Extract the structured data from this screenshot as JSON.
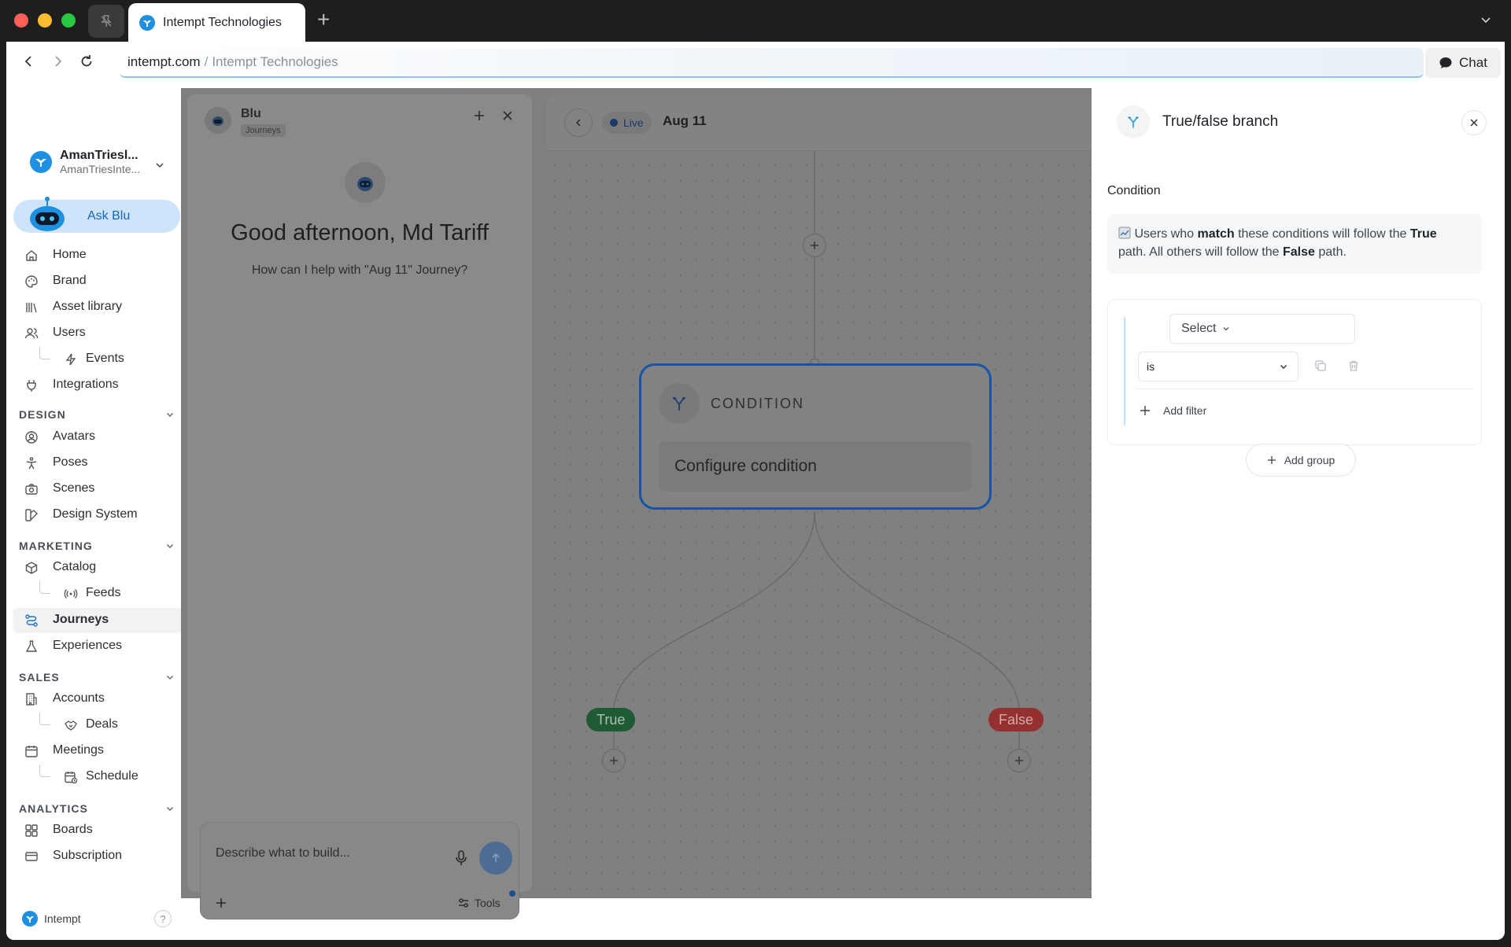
{
  "browser": {
    "tab_title": "Intempt Technologies",
    "url_domain": "intempt.com",
    "url_separator": "/",
    "url_path": "Intempt Technologies",
    "chat_label": "Chat"
  },
  "sidebar": {
    "workspace_name": "AmanTriesl...",
    "workspace_sub": "AmanTriesInte...",
    "ask_blu": "Ask Blu",
    "items": {
      "home": "Home",
      "brand": "Brand",
      "asset_library": "Asset library",
      "users": "Users",
      "events": "Events",
      "integrations": "Integrations",
      "avatars": "Avatars",
      "poses": "Poses",
      "scenes": "Scenes",
      "design_system": "Design System",
      "catalog": "Catalog",
      "feeds": "Feeds",
      "journeys": "Journeys",
      "experiences": "Experiences",
      "accounts": "Accounts",
      "deals": "Deals",
      "meetings": "Meetings",
      "schedule": "Schedule",
      "boards": "Boards",
      "subscription": "Subscription"
    },
    "sections": {
      "design": "DESIGN",
      "marketing": "MARKETING",
      "sales": "SALES",
      "analytics": "ANALYTICS"
    },
    "footer_brand": "Intempt",
    "help": "?"
  },
  "blu_panel": {
    "name": "Blu",
    "tag": "Journeys",
    "greeting": "Good afternoon, Md Tariff",
    "subtitle": "How can I help with \"Aug 11\" Journey?",
    "input_placeholder": "Describe what to build...",
    "tools_label": "Tools"
  },
  "canvas": {
    "status": "Live",
    "title": "Aug 11",
    "condition_title": "CONDITION",
    "condition_config": "Configure condition",
    "true_label": "True",
    "false_label": "False"
  },
  "right_panel": {
    "title": "True/false branch",
    "section_label": "Condition",
    "info_prefix": "Users who",
    "info_match": "match",
    "info_middle": "these conditions will follow the",
    "info_true": "True",
    "info_path1": "path. All others will follow the",
    "info_false": "False",
    "info_path2": "path.",
    "select_label": "Select",
    "operator_value": "is",
    "add_filter": "Add filter",
    "add_group": "Add group"
  },
  "colors": {
    "accent": "#1e8fe1",
    "condition_border": "#1655a6",
    "true_badge": "#1f5a34",
    "false_badge": "#933030",
    "ask_blu_bg": "#cde4fb"
  }
}
